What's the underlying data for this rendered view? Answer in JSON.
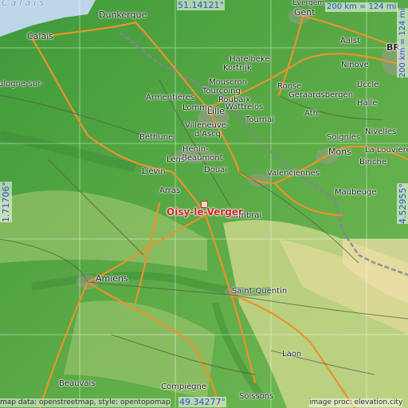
{
  "map": {
    "target": {
      "name": "Oisy-le-Verger"
    },
    "coordinates": {
      "lat_top": "51.14121°",
      "lat_bottom": "49.34277°",
      "lon_left": "1.71706°",
      "lon_right": "4.52955°"
    },
    "scale": {
      "km": "200 km = 124 mi"
    },
    "attribution": {
      "left": "map data: openstreetmap, style: opentopomap",
      "right": "image proc: elevation.city"
    },
    "sea_label": "Calais",
    "cities": [
      {
        "id": "dunkerque",
        "name": "Dunkerque"
      },
      {
        "id": "calais",
        "name": "Calais"
      },
      {
        "id": "boulogne",
        "name": "ulogne-sur-"
      },
      {
        "id": "gent",
        "name": "Gent"
      },
      {
        "id": "evergem",
        "name": "Evergem"
      },
      {
        "id": "aalst",
        "name": "Aalst"
      },
      {
        "id": "br1",
        "name": "BR"
      },
      {
        "id": "harelbeke",
        "name": "Harelbeke"
      },
      {
        "id": "kortrijk",
        "name": "Kortrijk"
      },
      {
        "id": "ninove",
        "name": "Ninove"
      },
      {
        "id": "mouscron",
        "name": "Mouscron"
      },
      {
        "id": "tourcoing",
        "name": "Tourcoing"
      },
      {
        "id": "ronse",
        "name": "Ronse"
      },
      {
        "id": "gerards",
        "name": "Geraardsbergen"
      },
      {
        "id": "uccle",
        "name": "Uccle"
      },
      {
        "id": "armentieres",
        "name": "Armentières"
      },
      {
        "id": "roubaix",
        "name": "Roubaix"
      },
      {
        "id": "wattrelos",
        "name": "Wattrelos"
      },
      {
        "id": "lomme",
        "name": "Lomme"
      },
      {
        "id": "lille",
        "name": "Lille"
      },
      {
        "id": "halle",
        "name": "Halle"
      },
      {
        "id": "villeneuve",
        "name": "Villeneuve-"
      },
      {
        "id": "dascq",
        "name": "d'Ascq"
      },
      {
        "id": "tournai",
        "name": "Tournai"
      },
      {
        "id": "ath",
        "name": "Ath"
      },
      {
        "id": "nivelles",
        "name": "Nivelles"
      },
      {
        "id": "bethune",
        "name": "Béthune"
      },
      {
        "id": "soignies",
        "name": "Soignies"
      },
      {
        "id": "henin",
        "name": "Hénin-"
      },
      {
        "id": "beaumont",
        "name": "Beaumont"
      },
      {
        "id": "lens",
        "name": "Lens"
      },
      {
        "id": "mons",
        "name": "Mons"
      },
      {
        "id": "lalouviere",
        "name": "La Louvière"
      },
      {
        "id": "lievin",
        "name": "Liévin"
      },
      {
        "id": "douai",
        "name": "Douai"
      },
      {
        "id": "valenciennes",
        "name": "Valenciennes"
      },
      {
        "id": "binche",
        "name": "Binche"
      },
      {
        "id": "arras",
        "name": "Arras"
      },
      {
        "id": "maubeuge",
        "name": "Maubeuge"
      },
      {
        "id": "cambrai",
        "name": "Cambrai"
      },
      {
        "id": "amiens",
        "name": "Amiens"
      },
      {
        "id": "stquentin",
        "name": "Saint-Quentin"
      },
      {
        "id": "laon",
        "name": "Laon"
      },
      {
        "id": "beauvais",
        "name": "Beauvais"
      },
      {
        "id": "compiegne",
        "name": "Compiègne"
      },
      {
        "id": "soissons",
        "name": "Soissons"
      }
    ]
  }
}
